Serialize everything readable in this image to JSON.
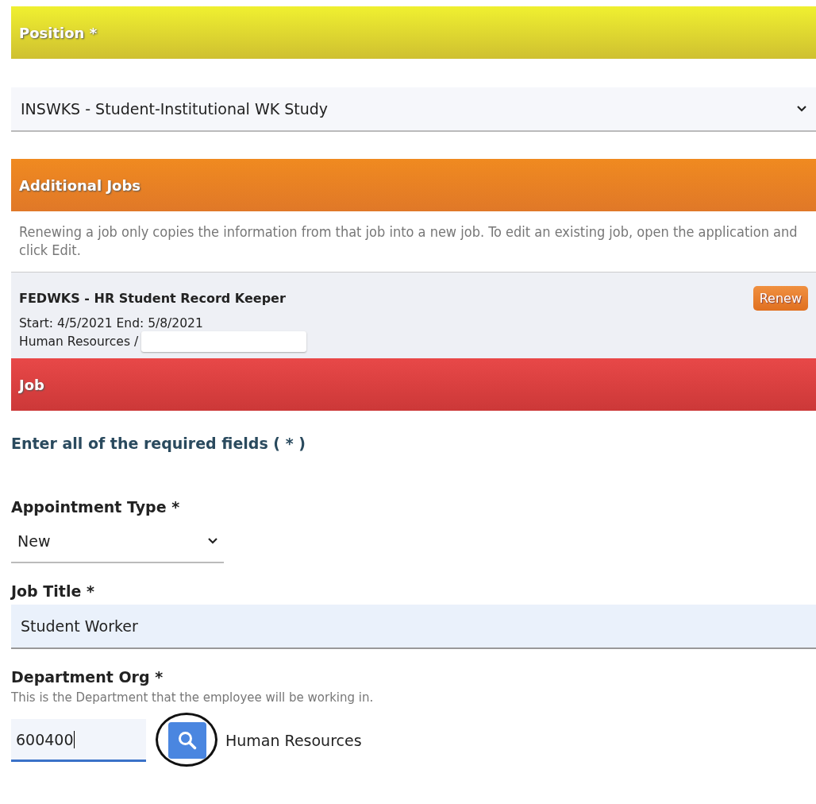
{
  "position_section": {
    "title": "Position *",
    "select": {
      "value": "INSWKS - Student-Institutional WK Study"
    }
  },
  "additional_jobs_section": {
    "title": "Additional Jobs",
    "note": "Renewing a job only copies the information from that job into a new job. To edit an existing job, open the application and click Edit.",
    "jobs": [
      {
        "title": "FEDWKS - HR Student Record Keeper",
        "dates": "Start: 4/5/2021 End: 5/8/2021",
        "department": "Human Resources /",
        "button": "Renew"
      }
    ]
  },
  "job_section": {
    "title": "Job",
    "instructions": "Enter all of the required fields ( * )",
    "fields": [
      {
        "kind": "select",
        "label": "Appointment Type *",
        "value": "New"
      },
      {
        "kind": "text",
        "label": "Job Title *",
        "value": "Student Worker"
      },
      {
        "kind": "lookup",
        "label": "Department Org *",
        "hint": "This is the Department that the employee will be working in.",
        "value": "600400",
        "result": "Human Resources",
        "highlighted": true
      }
    ]
  }
}
